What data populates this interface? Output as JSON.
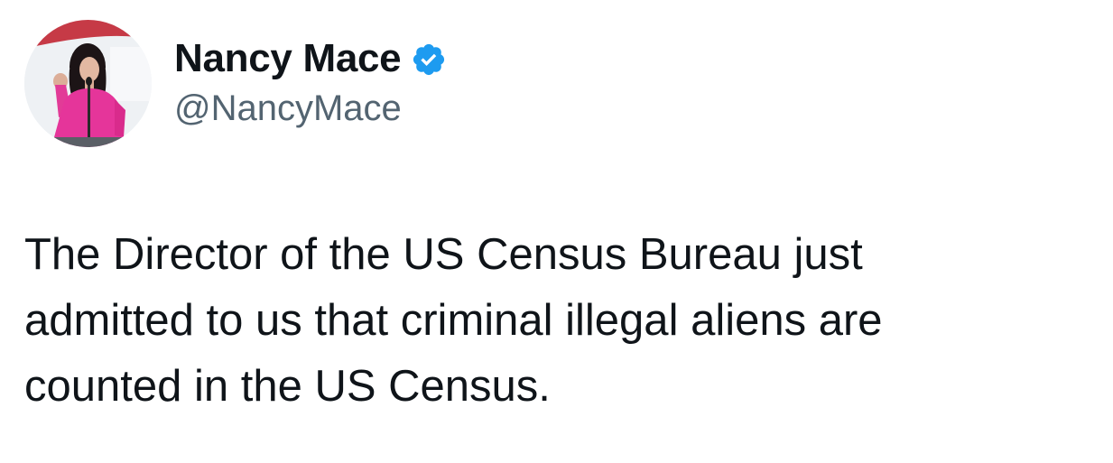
{
  "tweet": {
    "author": {
      "display_name": "Nancy Mace",
      "handle": "@NancyMace",
      "verified": true,
      "verified_icon": "verified-badge-icon",
      "avatar": "profile-photo"
    },
    "text_lines": [
      "The Director of the US Census Bureau just",
      "admitted to us that criminal illegal aliens are",
      "counted in the US Census."
    ]
  },
  "colors": {
    "text": "#0f1419",
    "secondary_text": "#536471",
    "verified_blue": "#1d9bf0",
    "background": "#ffffff"
  }
}
